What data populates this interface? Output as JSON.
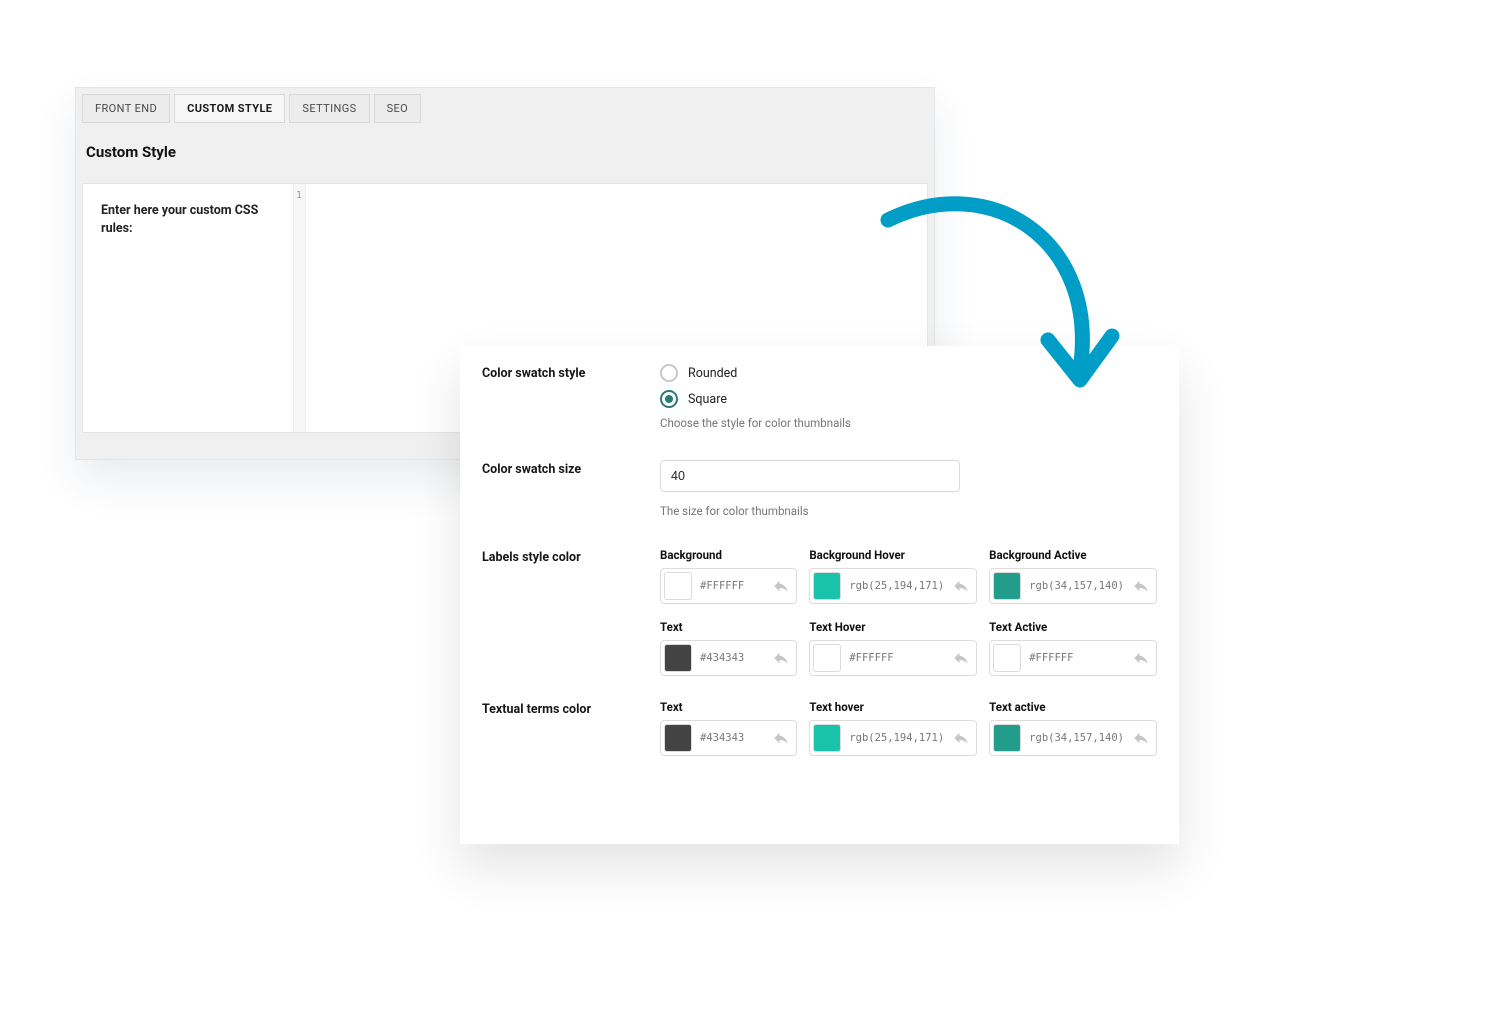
{
  "tabs": [
    {
      "label": "FRONT END",
      "active": false
    },
    {
      "label": "CUSTOM STYLE",
      "active": true
    },
    {
      "label": "SETTINGS",
      "active": false
    },
    {
      "label": "SEO",
      "active": false
    }
  ],
  "top_panel": {
    "title": "Custom Style",
    "css_label": "Enter here your custom CSS rules:",
    "line_number": "1"
  },
  "settings": {
    "swatch_style": {
      "label": "Color swatch style",
      "options": [
        {
          "label": "Rounded",
          "checked": false
        },
        {
          "label": "Square",
          "checked": true
        }
      ],
      "help": "Choose the style for color thumbnails"
    },
    "swatch_size": {
      "label": "Color swatch size",
      "value": "40",
      "help": "The size for color thumbnails"
    },
    "labels_color": {
      "label": "Labels style color",
      "items": [
        {
          "label": "Background",
          "value": "#FFFFFF",
          "swatch": "#ffffff"
        },
        {
          "label": "Background Hover",
          "value": "rgb(25,194,171)",
          "swatch": "rgb(25,194,171)"
        },
        {
          "label": "Background Active",
          "value": "rgb(34,157,140)",
          "swatch": "rgb(34,157,140)"
        },
        {
          "label": "Text",
          "value": "#434343",
          "swatch": "#434343"
        },
        {
          "label": "Text Hover",
          "value": "#FFFFFF",
          "swatch": "#ffffff"
        },
        {
          "label": "Text Active",
          "value": "#FFFFFF",
          "swatch": "#ffffff"
        }
      ]
    },
    "textual_color": {
      "label": "Textual terms color",
      "items": [
        {
          "label": "Text",
          "value": "#434343",
          "swatch": "#434343"
        },
        {
          "label": "Text hover",
          "value": "rgb(25,194,171)",
          "swatch": "rgb(25,194,171)"
        },
        {
          "label": "Text active",
          "value": "rgb(34,157,140)",
          "swatch": "rgb(34,157,140)"
        }
      ]
    }
  },
  "colors": {
    "accent_arrow": "#009ec6"
  }
}
